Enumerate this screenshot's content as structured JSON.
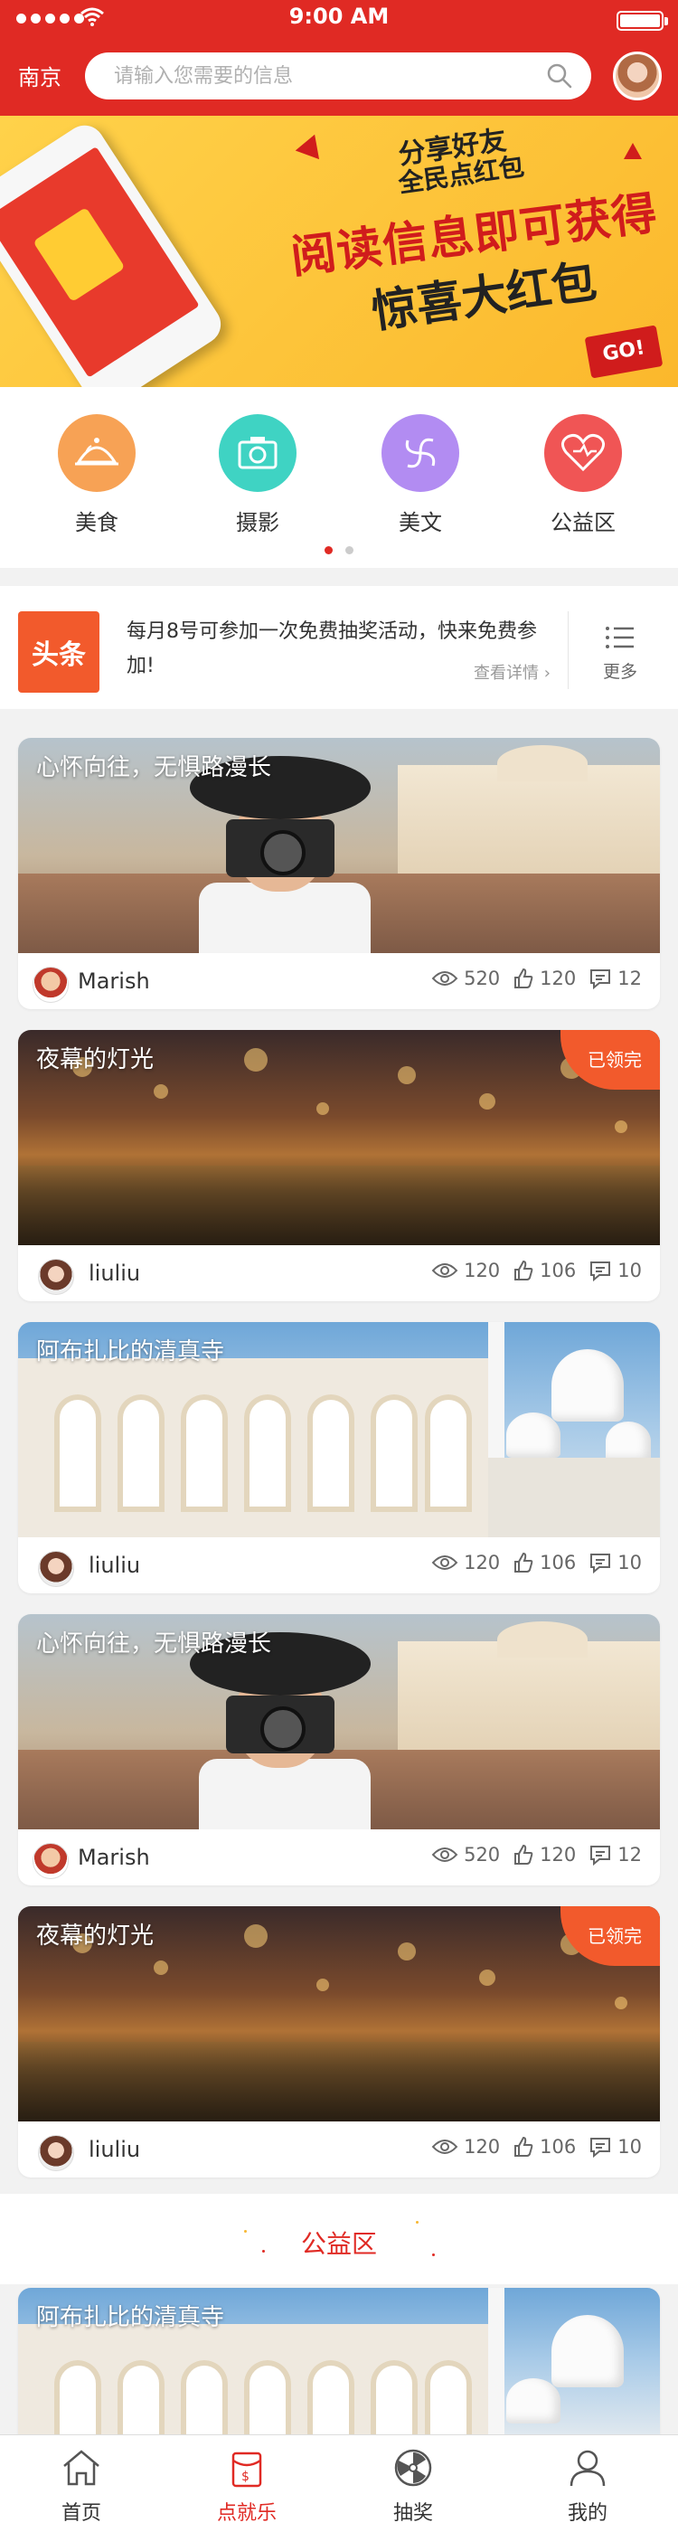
{
  "status": {
    "time": "9:00 AM"
  },
  "header": {
    "city": "南京",
    "search_placeholder": "请输入您需要的信息"
  },
  "banner": {
    "line1": "分享好友",
    "line2": "全民点红包",
    "line3": "阅读信息即可获得",
    "line4": "惊喜大红包",
    "go": "GO!"
  },
  "categories": [
    {
      "label": "美食",
      "icon": "cloche-icon",
      "color": "#f7a255"
    },
    {
      "label": "摄影",
      "icon": "camera-icon",
      "color": "#3fd3c3"
    },
    {
      "label": "美文",
      "icon": "swirl-icon",
      "color": "#b28cf2"
    },
    {
      "label": "公益区",
      "icon": "heart-icon",
      "color": "#f05555"
    }
  ],
  "headline": {
    "logo": "头条",
    "text": "每月8号可参加一次免费抽奖活动，快来免费参加!",
    "detail": "查看详情",
    "more": "更多"
  },
  "cards": [
    {
      "title": "心怀向往，无惧路漫长",
      "author": "Marish",
      "views": "520",
      "likes": "120",
      "comments": "12",
      "badge": ""
    },
    {
      "title": "夜幕的灯光",
      "author": "liuliu",
      "views": "120",
      "likes": "106",
      "comments": "10",
      "badge": "已领完"
    },
    {
      "title": "阿布扎比的清真寺",
      "author": "liuliu",
      "views": "120",
      "likes": "106",
      "comments": "10",
      "badge": ""
    },
    {
      "title": "心怀向往，无惧路漫长",
      "author": "Marish",
      "views": "520",
      "likes": "120",
      "comments": "12",
      "badge": ""
    },
    {
      "title": "夜幕的灯光",
      "author": "liuliu",
      "views": "120",
      "likes": "106",
      "comments": "10",
      "badge": "已领完"
    },
    {
      "title": "阿布扎比的清真寺"
    }
  ],
  "section": {
    "title": "公益区"
  },
  "tabbar": {
    "items": [
      {
        "label": "首页",
        "icon": "home-icon"
      },
      {
        "label": "点就乐",
        "icon": "redpacket-icon"
      },
      {
        "label": "抽奖",
        "icon": "wheel-icon"
      },
      {
        "label": "我的",
        "icon": "user-icon"
      }
    ],
    "active_color": "#e02a24"
  },
  "colors": {
    "brand": "#e02a24",
    "accent": "#f25a2c"
  }
}
